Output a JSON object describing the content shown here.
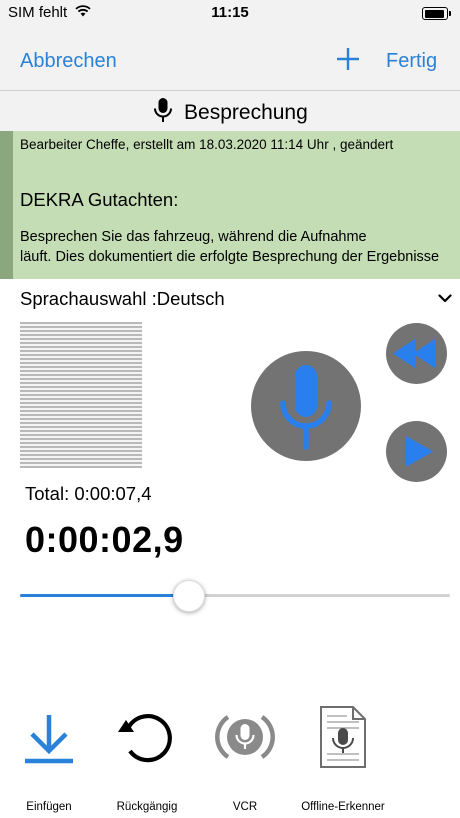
{
  "status": {
    "carrier": "SIM fehlt",
    "time": "11:15"
  },
  "nav": {
    "cancel_label": "Abbrechen",
    "done_label": "Fertig",
    "add_icon": "plus-icon"
  },
  "title": {
    "label": "Besprechung",
    "icon": "microphone-icon"
  },
  "info": {
    "meta": "Bearbeiter Cheffe, erstellt am 18.03.2020 11:14 Uhr , geändert",
    "heading": "DEKRA Gutachten:",
    "body_line1": "Besprechen Sie das fahrzeug, während die Aufnahme",
    "body_line2": "läuft. Dies dokumentiert die erfolgte Besprechung der Ergebnisse"
  },
  "language": {
    "label": "Sprachauswahl :Deutsch"
  },
  "player": {
    "total_label": "Total: 0:00:07,4",
    "current_time": "0:00:02,9",
    "progress": 0.39,
    "colors": {
      "accent": "#2a82d8",
      "button_bg": "#737373",
      "info_bg": "#c5ddb5"
    }
  },
  "toolbar": {
    "items": [
      {
        "label": "Einfügen",
        "icon": "download-icon"
      },
      {
        "label": "Rückgängig",
        "icon": "undo-icon"
      },
      {
        "label": "VCR",
        "icon": "vcr-microphone-icon"
      },
      {
        "label": "Offline-Erkenner",
        "icon": "offline-recognizer-icon"
      }
    ]
  }
}
